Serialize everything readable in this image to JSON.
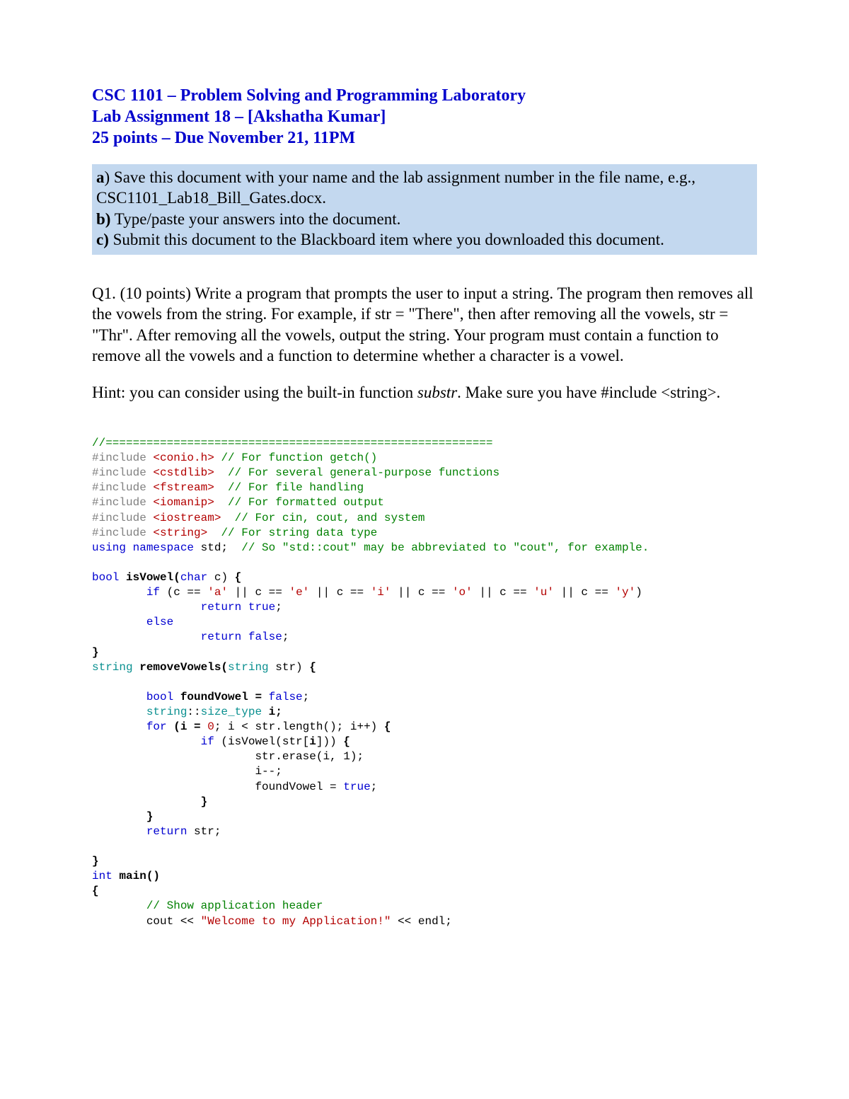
{
  "header": {
    "line1": "CSC 1101 – Problem Solving and Programming Laboratory",
    "line2": "Lab Assignment 18 – [Akshatha Kumar]",
    "line3": "25 points – Due November 21, 11PM"
  },
  "instructions": {
    "a_label": "a",
    "a_text": ") Save this document with your name and the lab assignment number in the file name, e.g., CSC1101_Lab18_Bill_Gates.docx.",
    "b_label": "b)",
    "b_text": " Type/paste your answers into the document.",
    "c_label": "c)",
    "c_text": " Submit this document to the Blackboard item where you downloaded this document."
  },
  "question1": {
    "text": "Q1. (10 points) Write a program that prompts the user to input a string. The program then removes all the vowels from the string. For example, if str = \"There\", then after removing all the vowels, str = \"Thr\". After removing all the vowels, output the string. Your program must contain a function to remove all the vowels and a function to determine whether a character is a vowel."
  },
  "hint": {
    "part1": "Hint: you can consider using the built-in function ",
    "substr": "substr",
    "part2": ". Make sure you have #include <string>."
  },
  "code": {
    "sep": "//=========================================================",
    "inc1a": "#include ",
    "inc1b": "<conio.h>",
    "inc1c": " // For function getch()",
    "inc2a": "#include ",
    "inc2b": "<cstdlib>",
    "inc2c": "  // For several general-purpose functions",
    "inc3a": "#include ",
    "inc3b": "<fstream>",
    "inc3c": "  // For file handling",
    "inc4a": "#include ",
    "inc4b": "<iomanip>",
    "inc4c": "  // For formatted output",
    "inc5a": "#include ",
    "inc5b": "<iostream>",
    "inc5c": "  // For cin, cout, and system",
    "inc6a": "#include ",
    "inc6b": "<string>",
    "inc6c": "  // For string data type",
    "ns_a": "using namespace",
    "ns_b": " std;  ",
    "ns_c": "// So \"std::cout\" may be abbreviated to \"cout\", for example.",
    "f1_a": "bool",
    "f1_b": " isVowel(",
    "f1_c": "char",
    "f1_d": " c) ",
    "f1_e": "{",
    "if_a": "        if",
    "if_b": " (c == ",
    "a": "'a'",
    "if_c": " || c == ",
    "e": "'e'",
    "if_d": " || c == ",
    "i": "'i'",
    "if_e": " || c == ",
    "o": "'o'",
    "if_f": " || c == ",
    "u": "'u'",
    "if_g": " || c == ",
    "y": "'y'",
    "if_h": ")",
    "rt_a": "                return true",
    "rt_b": ";",
    "else": "        else",
    "rf_a": "                return false",
    "rf_b": ";",
    "brace": "}",
    "f2_a": "string",
    "f2_b": " removeVowels(",
    "f2_c": "string",
    "f2_d": " str) ",
    "f2_e": "{",
    "bv_a": "        bool",
    "bv_b": " foundVowel = ",
    "bv_c": "false",
    "bv_d": ";",
    "sz_a": "        string",
    "sz_b": "::",
    "sz_c": "size_type",
    "sz_d": " i;",
    "for_a": "        for",
    "for_b": " (i = ",
    "for_c": "0",
    "for_d": "; i < str.length(); i++) ",
    "for_e": "{",
    "iv_a": "                if",
    "iv_b": " (isVowel(str[",
    "iv_c": "i",
    "iv_d": "])) ",
    "iv_e": "{",
    "er": "                        str.erase(i, 1);",
    "dec": "                        i--;",
    "fvt_a": "                        foundVowel = ",
    "fvt_b": "true",
    "fvt_c": ";",
    "cb1": "                }",
    "cb2": "        }",
    "ret_a": "        return",
    "ret_b": " str;",
    "main_a": "int",
    "main_b": " main()",
    "open": "{",
    "com": "        // Show application header",
    "co_a": "        cout << ",
    "co_b": "\"Welcome to my Application!\"",
    "co_c": " << endl;"
  }
}
